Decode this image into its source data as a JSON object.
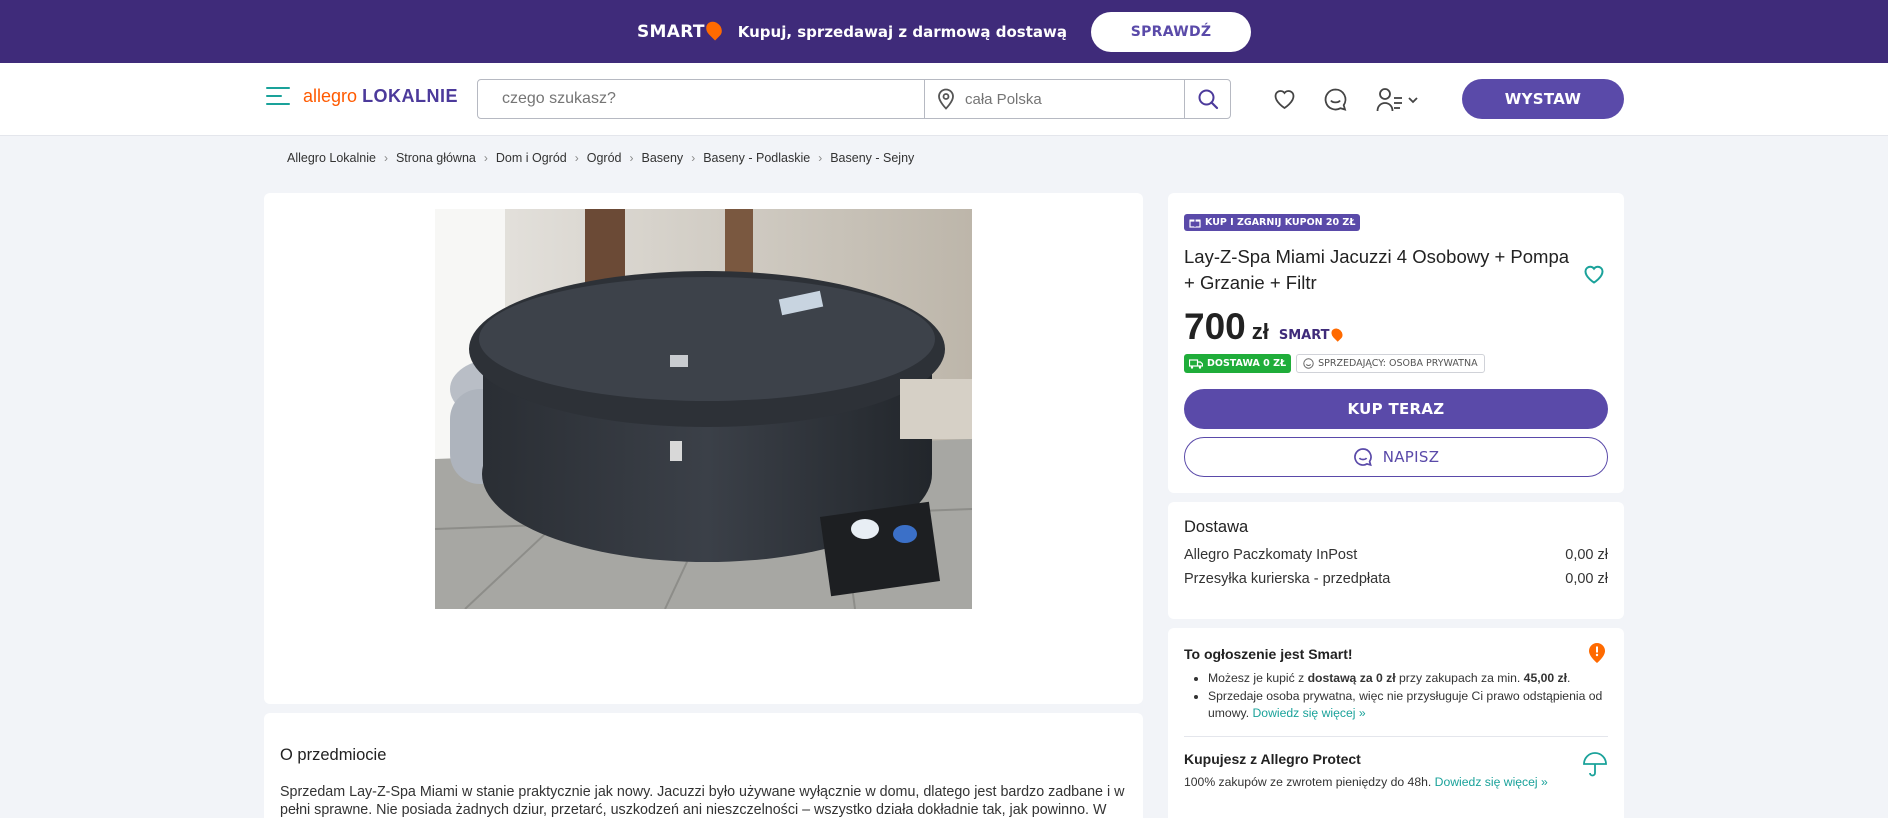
{
  "promo": {
    "brand": "SMART",
    "text": "Kupuj, sprzedawaj z darmową dostawą",
    "button": "SPRAWDŹ"
  },
  "header": {
    "logo_primary": "allegro",
    "logo_secondary": "LOKALNIE",
    "search_placeholder": "czego szukasz?",
    "location_placeholder": "cała Polska",
    "add_button": "WYSTAW"
  },
  "breadcrumb": [
    "Allegro Lokalnie",
    "Strona główna",
    "Dom i Ogród",
    "Ogród",
    "Baseny",
    "Baseny - Podlaskie",
    "Baseny - Sejny"
  ],
  "offer": {
    "coupon": "KUP I ZGARNIJ KUPON 20 ZŁ",
    "title": "Lay-Z-Spa Miami Jacuzzi 4 Osobowy + Pompa + Grzanie + Filtr",
    "price": "700",
    "currency": "zł",
    "smart": "SMART",
    "badge_delivery": "DOSTAWA 0 ZŁ",
    "badge_seller": "SPRZEDAJĄCY: OSOBA PRYWATNA",
    "buy_button": "KUP TERAZ",
    "message_button": "NAPISZ"
  },
  "delivery": {
    "heading": "Dostawa",
    "options": [
      {
        "name": "Allegro Paczkomaty InPost",
        "price": "0,00 zł"
      },
      {
        "name": "Przesyłka kurierska - przedpłata",
        "price": "0,00 zł"
      }
    ]
  },
  "smart_info": {
    "heading": "To ogłoszenie jest Smart!",
    "bullet1_a": "Możesz je kupić z ",
    "bullet1_b": "dostawą za 0 zł",
    "bullet1_c": " przy zakupach za min. ",
    "bullet1_d": "45,00 zł",
    "bullet1_e": ".",
    "bullet2": "Sprzedaje osoba prywatna, więc nie przysługuje Ci prawo odstąpienia od umowy. ",
    "bullet2_link": "Dowiedz się więcej »",
    "protect_heading": "Kupujesz z Allegro Protect",
    "protect_text": "100% zakupów ze zwrotem pieniędzy do 48h. ",
    "protect_link": "Dowiedz się więcej »"
  },
  "about": {
    "heading": "O przedmiocie",
    "text": "Sprzedam Lay-Z-Spa Miami w stanie praktycznie jak nowy. Jacuzzi było używane wyłącznie w domu, dlatego jest bardzo zadbane i w pełni sprawne. Nie posiada żadnych dziur, przetarć, uszkodzeń ani nieszczelności – wszystko działa dokładnie tak, jak powinno. W zestawie znajduje się pompa, podgrzewacz, system filtracji, pokrywa oraz komplet akcesoriów. Gotowe do użytku od razu po"
  },
  "colors": {
    "brand_purple": "#5a4aa9",
    "promo_bg": "#3f2b7a",
    "allegro_orange": "#ff5a00",
    "teal_link": "#1aa29a",
    "delivery_green": "#1fad3a"
  }
}
